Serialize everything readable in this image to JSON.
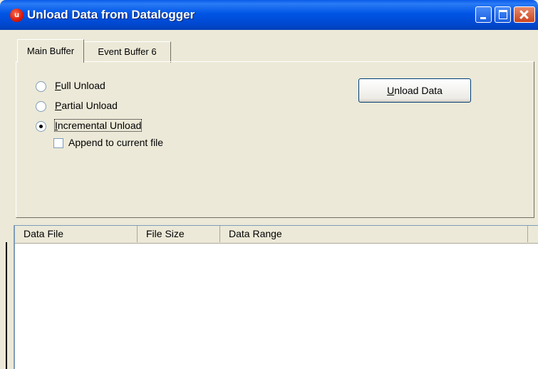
{
  "window": {
    "title": "Unload Data from Datalogger",
    "app_icon_glyph": "u"
  },
  "tabs": [
    {
      "label": "Main Buffer",
      "active": true
    },
    {
      "label": "Event Buffer 6",
      "active": false
    }
  ],
  "unload_options": {
    "full": {
      "label": "Full Unload",
      "selected": false
    },
    "partial": {
      "label": "Partial Unload",
      "selected": false
    },
    "incremental": {
      "label": "Incremental Unload",
      "selected": true
    },
    "append": {
      "label": "Append to current file",
      "checked": false
    }
  },
  "unload_button": {
    "label": "Unload Data"
  },
  "table": {
    "columns": [
      "Data File",
      "File Size",
      "Data Range",
      ""
    ],
    "rows": []
  },
  "colors": {
    "titlebar": "#0055e5",
    "dialog_bg": "#ece9d8"
  }
}
